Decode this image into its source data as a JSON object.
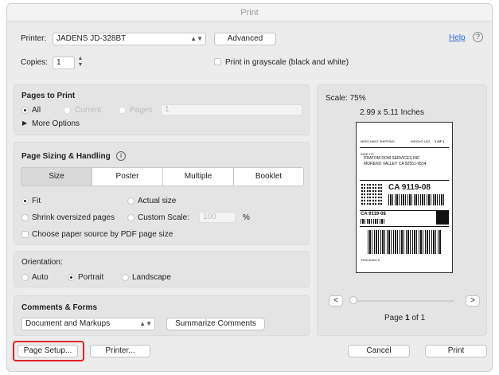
{
  "window": {
    "title": "Print"
  },
  "printer": {
    "label": "Printer:",
    "value": "JADENS JD-328BT",
    "advanced_label": "Advanced",
    "help_label": "Help",
    "help_icon_text": "?"
  },
  "copies": {
    "label": "Copies:",
    "value": "1",
    "grayscale_label": "Print in grayscale (black and white)"
  },
  "pages_to_print": {
    "title": "Pages to Print",
    "all_label": "All",
    "current_label": "Current",
    "pages_label": "Pages",
    "pages_value": "1",
    "more_options_label": "More Options"
  },
  "sizing": {
    "title": "Page Sizing & Handling",
    "info_icon_text": "i",
    "tabs": [
      "Size",
      "Poster",
      "Multiple",
      "Booklet"
    ],
    "fit_label": "Fit",
    "actual_size_label": "Actual size",
    "shrink_label": "Shrink oversized pages",
    "custom_scale_label": "Custom Scale:",
    "custom_scale_value": "100",
    "percent_label": "%",
    "paper_source_label": "Choose paper source by PDF page size"
  },
  "orientation": {
    "title": "Orientation:",
    "auto_label": "Auto",
    "portrait_label": "Portrait",
    "landscape_label": "Landscape"
  },
  "comments": {
    "title": "Comments & Forms",
    "select_value": "Document and Markups",
    "summarize_label": "Summarize Comments"
  },
  "preview": {
    "scale_label": "Scale: 75%",
    "size_label": "2.99 x 5.11 Inches",
    "prev_label": "<",
    "next_label": ">",
    "page_prefix": "Page",
    "page_current": "1",
    "page_suffix": "of 1",
    "label_text": {
      "line1": "MERCHANT SHIPPING",
      "line2": "WEIGHT LBS",
      "line3": "1 OF 1",
      "ship_to": "SHIP TO:",
      "company": "PRATOM DOM SERVICES INC",
      "address": "MORENO VALLEY CA 92551-9534",
      "route": "CA 9119-08",
      "route2": "CA 9119-08",
      "tracking": "TRACKING #"
    }
  },
  "footer": {
    "page_setup_label": "Page Setup...",
    "printer_label": "Printer...",
    "cancel_label": "Cancel",
    "print_label": "Print"
  },
  "colors": {
    "highlight_red": "#e0242b",
    "link_blue": "#2a6bd6"
  }
}
